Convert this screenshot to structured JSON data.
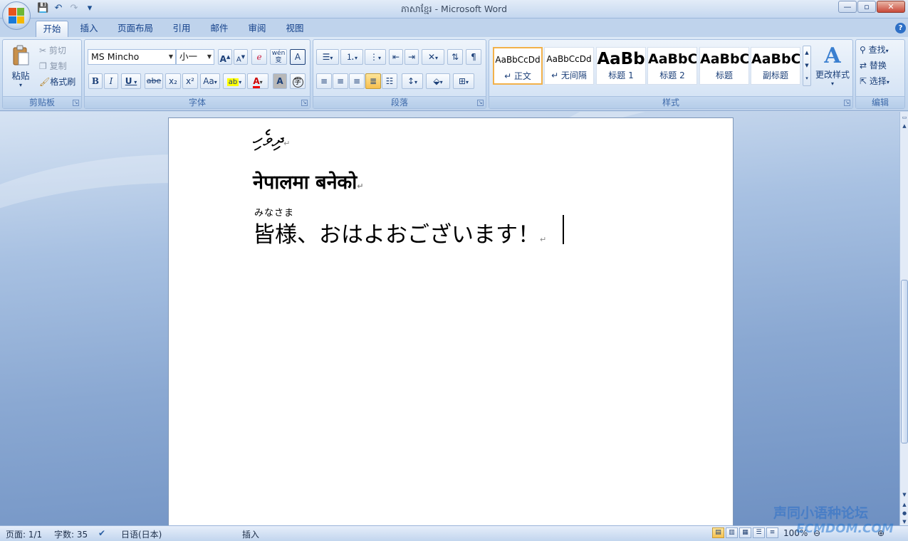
{
  "window": {
    "title": "ភាសាខ្មែរ - Microsoft Word",
    "minimize": "—",
    "maximize": "▫",
    "close": "✕"
  },
  "qat": {
    "save": "💾",
    "undo": "↶",
    "redo": "↷",
    "customize": "▾"
  },
  "tabs": [
    "开始",
    "插入",
    "页面布局",
    "引用",
    "邮件",
    "审阅",
    "视图"
  ],
  "ribbon": {
    "clipboard": {
      "label": "剪贴板",
      "paste": "粘贴",
      "cut": "剪切",
      "copy": "复制",
      "format_painter": "格式刷"
    },
    "font": {
      "label": "字体",
      "font_name": "MS Mincho",
      "font_size": "小一",
      "bold": "B",
      "italic": "I",
      "underline": "U",
      "strike": "abe",
      "subscript": "x₂",
      "superscript": "x²",
      "change_case": "Aa",
      "grow": "A",
      "shrink": "A",
      "clear": "ꭤ",
      "phonetic": "wén",
      "border_char": "A",
      "shading": "A",
      "enclose": "字"
    },
    "paragraph": {
      "label": "段落"
    },
    "styles": {
      "label": "样式",
      "items": [
        {
          "preview": "AaBbCcDd",
          "name": "↵ 正文"
        },
        {
          "preview": "AaBbCcDd",
          "name": "↵ 无间隔"
        },
        {
          "preview": "AaBb",
          "name": "标题 1"
        },
        {
          "preview": "AaBbC",
          "name": "标题 2"
        },
        {
          "preview": "AaBbC",
          "name": "标题"
        },
        {
          "preview": "AaBbC",
          "name": "副标题"
        }
      ],
      "change_styles": "更改样式"
    },
    "editing": {
      "label": "编辑",
      "find": "查找",
      "replace": "替换",
      "select": "选择"
    }
  },
  "document": {
    "line1": "ދިވެހި",
    "line2": "नेपालमा बनेको",
    "ruby": "みなさま",
    "line3": "皆様、おはよおございます！",
    "pilcrow": "↵"
  },
  "status": {
    "page": "页面: 1/1",
    "words": "字数: 35",
    "language": "日语(日本)",
    "mode": "插入",
    "zoom": "100%"
  },
  "watermark": {
    "text": "声同小语种论坛",
    "url": "ECMDOM.COM"
  }
}
